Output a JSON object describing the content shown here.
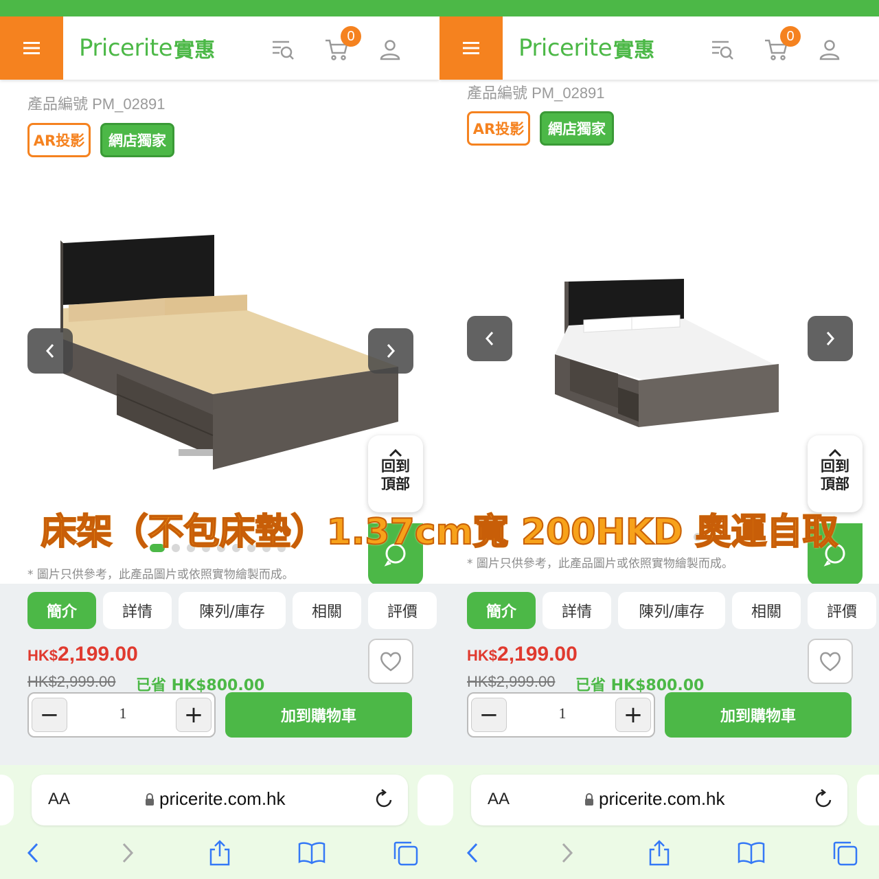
{
  "header": {
    "logo_latin": "Pricerite",
    "logo_cjk": "實惠",
    "cart_count": "0",
    "icons": [
      "menu-icon",
      "search-list-icon",
      "cart-icon",
      "user-icon"
    ]
  },
  "product": {
    "sku": "產品編號 PM_02891",
    "tags": [
      "AR投影",
      "網店獨家"
    ],
    "disclaimer": "* 圖片只供參考，此產品圖片或依照實物繪製而成。",
    "back_to_top": "回到頂部",
    "tabs": [
      "簡介",
      "詳情",
      "陳列/庫存",
      "相關",
      "評價"
    ],
    "price_currency": "HK$",
    "price_amount": "2,199.00",
    "old_price": "HK$2,999.00",
    "saved": "已省 HK$800.00",
    "quantity": "1",
    "add_to_cart": "加到購物車"
  },
  "browser": {
    "aa": "AA",
    "url": "pricerite.com.hk"
  },
  "overlay_banner": "床架（不包床墊）1.37cm寬  200HKD  奧運自取",
  "colors": {
    "brand_green": "#4cb847",
    "brand_orange": "#f5821f",
    "price_red": "#e03a2f"
  }
}
